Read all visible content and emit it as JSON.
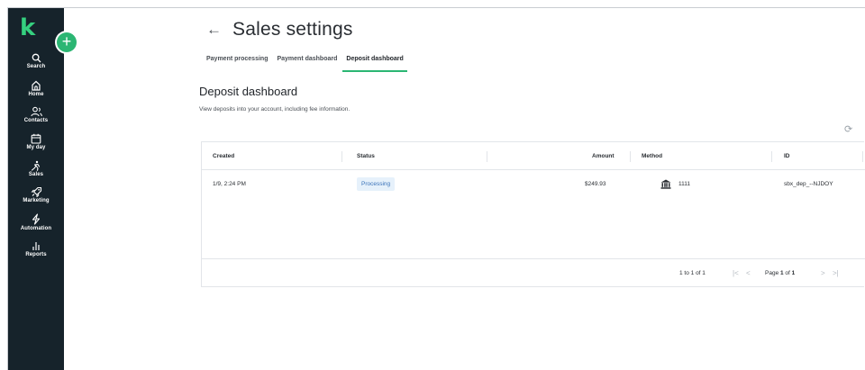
{
  "sidebar": {
    "logo": "k",
    "add_label": "+",
    "items": [
      {
        "label": "Search",
        "icon": "search-icon"
      },
      {
        "label": "Home",
        "icon": "home-icon"
      },
      {
        "label": "Contacts",
        "icon": "contacts-icon"
      },
      {
        "label": "My day",
        "icon": "calendar-icon"
      },
      {
        "label": "Sales",
        "icon": "sales-icon"
      },
      {
        "label": "Marketing",
        "icon": "marketing-icon"
      },
      {
        "label": "Automation",
        "icon": "automation-icon"
      },
      {
        "label": "Reports",
        "icon": "reports-icon"
      }
    ]
  },
  "header": {
    "back_icon": "arrow-left-icon",
    "back_glyph": "←",
    "title": "Sales settings"
  },
  "tabs": [
    {
      "label": "Payment processing",
      "active": false
    },
    {
      "label": "Payment dashboard",
      "active": false
    },
    {
      "label": "Deposit dashboard",
      "active": true
    }
  ],
  "section": {
    "title": "Deposit dashboard",
    "description": "View deposits into your account, including fee information.",
    "refresh_icon": "refresh-icon",
    "refresh_glyph": "⟳"
  },
  "table": {
    "columns": [
      "Created",
      "Status",
      "Amount",
      "Method",
      "ID"
    ],
    "rows": [
      {
        "created": "1/9, 2:24 PM",
        "status": "Processing",
        "amount": "$249.93",
        "method_icon": "bank-icon",
        "method": "1111",
        "id": "sbx_dep_--NJDOY"
      }
    ],
    "accent_color": "#2bb673",
    "badge_color": "#e6f1fb"
  },
  "pagination": {
    "range": "1 to 1 of 1",
    "page_prefix": "Page ",
    "page_current": "1",
    "page_of": " of ",
    "page_total": "1",
    "first": "|<",
    "prev": "<",
    "next": ">",
    "last": ">|"
  }
}
